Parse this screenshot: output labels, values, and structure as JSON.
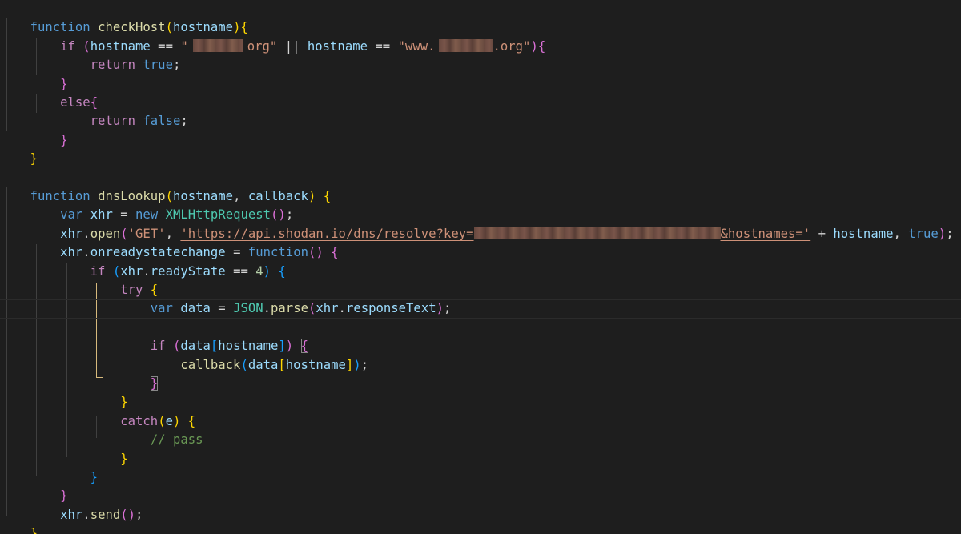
{
  "editor": {
    "theme_colors": {
      "background": "#1e1e1e",
      "keyword": "#569cd6",
      "control": "#c586c0",
      "function": "#dcdcaa",
      "variable": "#9cdcfe",
      "string": "#ce9178",
      "number": "#b5cea8",
      "class": "#4ec9b0",
      "comment": "#6a9955",
      "bracket_1": "#ffd700",
      "bracket_2": "#da70d6",
      "bracket_3": "#179fff"
    },
    "tokens": {
      "l1": [
        "function",
        " ",
        "checkHost",
        "(",
        "hostname",
        ")",
        "{"
      ],
      "l2": [
        "if",
        " ",
        "(",
        "hostname",
        " == ",
        "\"",
        "org\"",
        " || ",
        "hostname",
        " == ",
        "\"www.",
        ".org\"",
        ")",
        "{"
      ],
      "l3": [
        "return",
        " ",
        "true",
        ";"
      ],
      "l4": [
        "}"
      ],
      "l5": [
        "else",
        "{"
      ],
      "l6": [
        "return",
        " ",
        "false",
        ";"
      ],
      "l7": [
        "}"
      ],
      "l8": [
        "}"
      ],
      "l10": [
        "function",
        " ",
        "dnsLookup",
        "(",
        "hostname",
        ", ",
        "callback",
        ") ",
        "{"
      ],
      "l11": [
        "var",
        " ",
        "xhr",
        " = ",
        "new",
        " ",
        "XMLHttpRequest",
        "(",
        ")",
        ";"
      ],
      "l12": [
        "xhr",
        ".",
        "open",
        "(",
        "'GET'",
        ", ",
        "'https://api.shodan.io/dns/resolve?key=",
        "&hostnames='",
        " + ",
        "hostname",
        ", ",
        "true",
        ")",
        ";"
      ],
      "l13": [
        "xhr",
        ".",
        "onreadystatechange",
        " = ",
        "function",
        "(",
        ")",
        " ",
        "{"
      ],
      "l14": [
        "if",
        " ",
        "(",
        "xhr",
        ".",
        "readyState",
        " == ",
        "4",
        ") ",
        "{"
      ],
      "l15": [
        "try",
        " ",
        "{"
      ],
      "l16": [
        "var",
        " ",
        "data",
        " = ",
        "JSON",
        ".",
        "parse",
        "(",
        "xhr",
        ".",
        "responseText",
        ")",
        ";"
      ],
      "l18": [
        "if",
        " ",
        "(",
        "data",
        "[",
        "hostname",
        "]",
        ") ",
        "{"
      ],
      "l19": [
        "callback",
        "(",
        "data",
        "[",
        "hostname",
        "]",
        ")",
        ";"
      ],
      "l20": [
        "}"
      ],
      "l21": [
        "}"
      ],
      "l22": [
        "catch",
        "(",
        "e",
        ") ",
        "{"
      ],
      "l23": [
        "// pass"
      ],
      "l24": [
        "}"
      ],
      "l25": [
        "}"
      ],
      "l26": [
        "}"
      ],
      "l27": [
        "xhr",
        ".",
        "send",
        "(",
        ")",
        ";"
      ],
      "l28": [
        "}"
      ]
    }
  }
}
